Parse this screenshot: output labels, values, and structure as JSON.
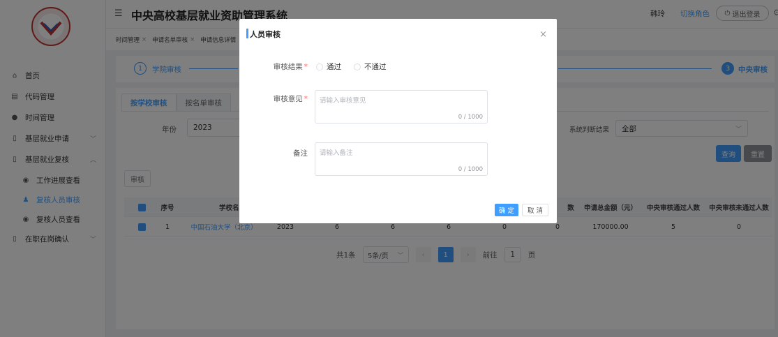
{
  "app": {
    "title": "中央高校基层就业资助管理系统",
    "user": "韩玲",
    "switch_role": "切换角色",
    "logout": "退出登录"
  },
  "sidebar": {
    "items": [
      {
        "label": "首页",
        "icon": "home-icon"
      },
      {
        "label": "代码管理",
        "icon": "code-icon"
      },
      {
        "label": "时间管理",
        "icon": "clock-icon"
      },
      {
        "label": "基层就业申请",
        "icon": "document-icon"
      },
      {
        "label": "基层就业复核",
        "icon": "document-icon"
      },
      {
        "label": "工作进展查看",
        "icon": "eye-icon"
      },
      {
        "label": "复核人员审核",
        "icon": "person-icon"
      },
      {
        "label": "复核人员查看",
        "icon": "eye-icon"
      },
      {
        "label": "在职在岗确认",
        "icon": "document-icon"
      }
    ]
  },
  "tags": [
    {
      "label": "时间管理"
    },
    {
      "label": "申请名单审核"
    },
    {
      "label": "申请信息详情"
    }
  ],
  "steps": [
    {
      "num": "1",
      "label": "学院审核"
    },
    {
      "num": "3",
      "label": "中央审核"
    }
  ],
  "tabs": [
    {
      "label": "按学校审核"
    },
    {
      "label": "按名单审核"
    }
  ],
  "filters": {
    "year_label": "年份",
    "year_value": "2023",
    "judge_label": "系统判断结果",
    "judge_value": "全部",
    "query": "查询",
    "reset": "重置"
  },
  "review_button": "审核",
  "table": {
    "headers": [
      "序号",
      "学校名称",
      "数",
      "申请总金额（元）",
      "中央审核通过人数",
      "中央审核未通过人数"
    ],
    "rows": [
      {
        "index": "1",
        "school": "中国石油大学（北京）",
        "year": "2023",
        "c1": "6",
        "c2": "6",
        "c3": "6",
        "c4": "0",
        "c5": "0",
        "amount": "170000.00",
        "passed": "5",
        "failed": "0"
      }
    ]
  },
  "pagination": {
    "total": "共1条",
    "page_size": "5条/页",
    "current_page": "1",
    "goto_label": "前往",
    "goto_value": "1",
    "page_suffix": "页"
  },
  "dialog": {
    "title": "人员审核",
    "result_label": "审核结果",
    "result_options": [
      "通过",
      "不通过"
    ],
    "opinion_label": "审核意见",
    "opinion_placeholder": "请输入审核意见",
    "opinion_count": "0 / 1000",
    "remark_label": "备注",
    "remark_placeholder": "请输入备注",
    "remark_count": "0 / 1000",
    "confirm": "确 定",
    "cancel": "取 消"
  },
  "colors": {
    "primary": "#409eff",
    "required": "#f56c6c"
  }
}
